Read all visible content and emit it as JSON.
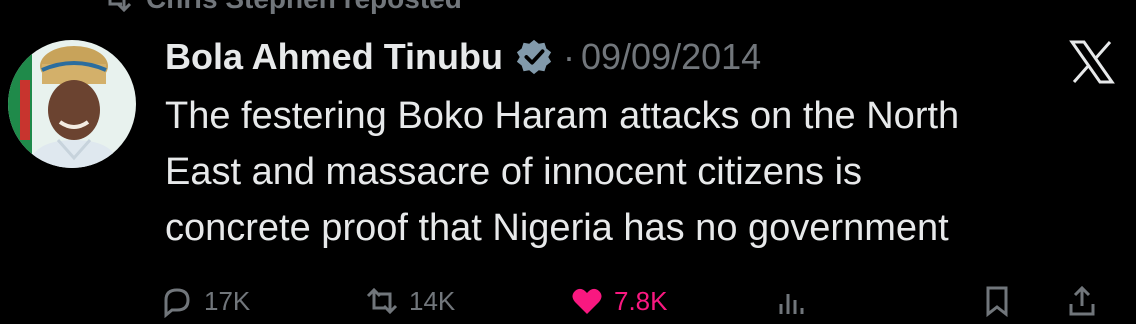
{
  "repost": {
    "label": "Chris Stephen reposted"
  },
  "tweet": {
    "author_name": "Bola Ahmed Tinubu",
    "separator": "·",
    "date": "09/09/2014",
    "text_lines": [
      "The festering Boko Haram attacks on the North",
      "East and massacre of innocent citizens is",
      "concrete proof that Nigeria has no government"
    ]
  },
  "actions": {
    "replies": "17K",
    "reposts": "14K",
    "likes": "7.8K"
  },
  "icons": {
    "repost_indicator": "repost-icon",
    "verified": "verified-badge-icon",
    "brand": "x-logo-icon",
    "reply": "reply-icon",
    "retweet": "retweet-icon",
    "like": "heart-icon",
    "views": "views-icon",
    "bookmark": "bookmark-icon",
    "share": "share-icon"
  },
  "colors": {
    "background": "#000000",
    "text": "#e7e9ea",
    "muted": "#71767b",
    "verified": "#829aab",
    "like": "#f91880"
  }
}
